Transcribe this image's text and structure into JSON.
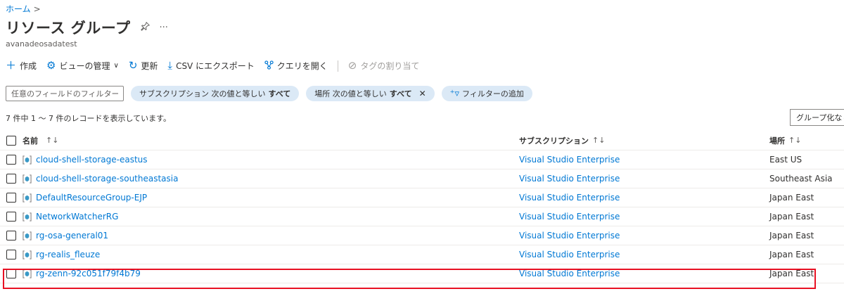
{
  "breadcrumb": {
    "home": "ホーム",
    "separator": ">"
  },
  "page": {
    "title": "リソース グループ",
    "subtitle": "avanadeosadatest"
  },
  "toolbar": {
    "create": "作成",
    "manage_view": "ビューの管理",
    "refresh": "更新",
    "export_csv": "CSV にエクスポート",
    "open_query": "クエリを開く",
    "assign_tags": "タグの割り当て"
  },
  "filters": {
    "placeholder": "任意のフィールドのフィルター...",
    "subscription_prefix": "サブスクリプション 次の値と等しい",
    "subscription_value": "すべて",
    "location_prefix": "場所 次の値と等しい",
    "location_value": "すべて",
    "add_filter": "フィルターの追加"
  },
  "record_count": "7 件中 1 ～ 7 件のレコードを表示しています。",
  "group_by": "グループ化なし",
  "table": {
    "headers": {
      "name": "名前",
      "subscription": "サブスクリプション",
      "location": "場所",
      "sort_icon": "↑↓"
    },
    "rows": [
      {
        "name": "cloud-shell-storage-eastus",
        "subscription": "Visual Studio Enterprise",
        "location": "East US"
      },
      {
        "name": "cloud-shell-storage-southeastasia",
        "subscription": "Visual Studio Enterprise",
        "location": "Southeast Asia"
      },
      {
        "name": "DefaultResourceGroup-EJP",
        "subscription": "Visual Studio Enterprise",
        "location": "Japan East"
      },
      {
        "name": "NetworkWatcherRG",
        "subscription": "Visual Studio Enterprise",
        "location": "Japan East"
      },
      {
        "name": "rg-osa-general01",
        "subscription": "Visual Studio Enterprise",
        "location": "Japan East"
      },
      {
        "name": "rg-realis_fleuze",
        "subscription": "Visual Studio Enterprise",
        "location": "Japan East"
      },
      {
        "name": "rg-zenn-92c051f79f4b79",
        "subscription": "Visual Studio Enterprise",
        "location": "Japan East"
      }
    ]
  },
  "colors": {
    "accent": "#0078d4",
    "highlight": "#e81123",
    "pill": "#dbe9f6"
  },
  "icons": [
    "plus-icon",
    "gear-icon",
    "chevron-down-icon",
    "refresh-icon",
    "download-icon",
    "query-icon",
    "tag-icon",
    "pin-icon",
    "more-icon",
    "close-icon",
    "add-filter-icon",
    "resource-group-icon"
  ]
}
